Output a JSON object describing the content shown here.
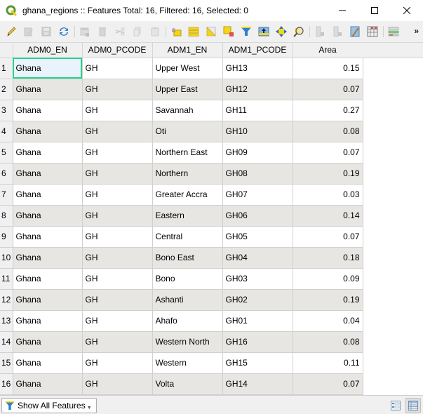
{
  "window": {
    "title": "ghana_regions :: Features Total: 16, Filtered: 16, Selected: 0",
    "controls": [
      "minimize-icon",
      "maximize-icon",
      "close-icon"
    ]
  },
  "toolbar": {
    "buttons": [
      {
        "icon": "pencil-edit-icon",
        "label": "Toggle editing mode",
        "enabled": true
      },
      {
        "icon": "multi-edit-icon",
        "label": "Toggle multi edit mode",
        "enabled": false
      },
      {
        "icon": "save-edits-icon",
        "label": "Save edits",
        "enabled": false
      },
      {
        "icon": "reload-icon",
        "label": "Reload the table",
        "enabled": true
      },
      {
        "icon": "add-feature-icon",
        "label": "Add feature",
        "enabled": false
      },
      {
        "icon": "delete-feature-icon",
        "label": "Delete selected features",
        "enabled": false
      },
      {
        "icon": "cut-icon",
        "label": "Cut selected rows",
        "enabled": false
      },
      {
        "icon": "copy-icon",
        "label": "Copy selected rows",
        "enabled": false
      },
      {
        "icon": "paste-icon",
        "label": "Paste features",
        "enabled": false
      },
      {
        "icon": "select-by-expression-icon",
        "label": "Select features using an expression",
        "enabled": true
      },
      {
        "icon": "select-all-icon",
        "label": "Select all",
        "enabled": true
      },
      {
        "icon": "invert-selection-icon",
        "label": "Invert selection",
        "enabled": true
      },
      {
        "icon": "deselect-all-icon",
        "label": "Deselect all",
        "enabled": true
      },
      {
        "icon": "filter-icon",
        "label": "Filter/Select features using form",
        "enabled": true
      },
      {
        "icon": "move-selection-top-icon",
        "label": "Move selection to top",
        "enabled": true
      },
      {
        "icon": "pan-to-selection-icon",
        "label": "Pan map to selected rows",
        "enabled": true
      },
      {
        "icon": "zoom-to-selection-icon",
        "label": "Zoom map to selected rows",
        "enabled": true
      },
      {
        "icon": "new-field-icon",
        "label": "New field",
        "enabled": false
      },
      {
        "icon": "delete-field-icon",
        "label": "Delete field",
        "enabled": false
      },
      {
        "icon": "field-calculator-icon",
        "label": "Open field calculator",
        "enabled": true
      },
      {
        "icon": "conditional-formatting-icon",
        "label": "Conditional formatting",
        "enabled": true
      },
      {
        "icon": "actions-icon",
        "label": "Actions",
        "enabled": true
      }
    ],
    "more_label": "»"
  },
  "table": {
    "columns": [
      "ADM0_EN",
      "ADM0_PCODE",
      "ADM1_EN",
      "ADM1_PCODE",
      "Area"
    ],
    "rows": [
      {
        "n": "1",
        "adm0_en": "Ghana",
        "adm0_pcode": "GH",
        "adm1_en": "Upper West",
        "adm1_pcode": "GH13",
        "area": "0.15"
      },
      {
        "n": "2",
        "adm0_en": "Ghana",
        "adm0_pcode": "GH",
        "adm1_en": "Upper East",
        "adm1_pcode": "GH12",
        "area": "0.07"
      },
      {
        "n": "3",
        "adm0_en": "Ghana",
        "adm0_pcode": "GH",
        "adm1_en": "Savannah",
        "adm1_pcode": "GH11",
        "area": "0.27"
      },
      {
        "n": "4",
        "adm0_en": "Ghana",
        "adm0_pcode": "GH",
        "adm1_en": "Oti",
        "adm1_pcode": "GH10",
        "area": "0.08"
      },
      {
        "n": "5",
        "adm0_en": "Ghana",
        "adm0_pcode": "GH",
        "adm1_en": "Northern East",
        "adm1_pcode": "GH09",
        "area": "0.07"
      },
      {
        "n": "6",
        "adm0_en": "Ghana",
        "adm0_pcode": "GH",
        "adm1_en": "Northern",
        "adm1_pcode": "GH08",
        "area": "0.19"
      },
      {
        "n": "7",
        "adm0_en": "Ghana",
        "adm0_pcode": "GH",
        "adm1_en": "Greater Accra",
        "adm1_pcode": "GH07",
        "area": "0.03"
      },
      {
        "n": "8",
        "adm0_en": "Ghana",
        "adm0_pcode": "GH",
        "adm1_en": "Eastern",
        "adm1_pcode": "GH06",
        "area": "0.14"
      },
      {
        "n": "9",
        "adm0_en": "Ghana",
        "adm0_pcode": "GH",
        "adm1_en": "Central",
        "adm1_pcode": "GH05",
        "area": "0.07"
      },
      {
        "n": "10",
        "adm0_en": "Ghana",
        "adm0_pcode": "GH",
        "adm1_en": "Bono East",
        "adm1_pcode": "GH04",
        "area": "0.18"
      },
      {
        "n": "11",
        "adm0_en": "Ghana",
        "adm0_pcode": "GH",
        "adm1_en": "Bono",
        "adm1_pcode": "GH03",
        "area": "0.09"
      },
      {
        "n": "12",
        "adm0_en": "Ghana",
        "adm0_pcode": "GH",
        "adm1_en": "Ashanti",
        "adm1_pcode": "GH02",
        "area": "0.19"
      },
      {
        "n": "13",
        "adm0_en": "Ghana",
        "adm0_pcode": "GH",
        "adm1_en": "Ahafo",
        "adm1_pcode": "GH01",
        "area": "0.04"
      },
      {
        "n": "14",
        "adm0_en": "Ghana",
        "adm0_pcode": "GH",
        "adm1_en": "Western North",
        "adm1_pcode": "GH16",
        "area": "0.08"
      },
      {
        "n": "15",
        "adm0_en": "Ghana",
        "adm0_pcode": "GH",
        "adm1_en": "Western",
        "adm1_pcode": "GH15",
        "area": "0.11"
      },
      {
        "n": "16",
        "adm0_en": "Ghana",
        "adm0_pcode": "GH",
        "adm1_en": "Volta",
        "adm1_pcode": "GH14",
        "area": "0.07"
      }
    ]
  },
  "bottombar": {
    "filter_button_label": "Show All Features",
    "form_view_icon": "form-view-icon",
    "table_view_icon": "table-view-icon"
  },
  "colors": {
    "selection_outline": "#2bd18a",
    "alt_row": "#e8e6e3",
    "toolbar_bg": "#f0f0f0",
    "qgis_green": "#589632",
    "qgis_yellow": "#eec90d"
  }
}
